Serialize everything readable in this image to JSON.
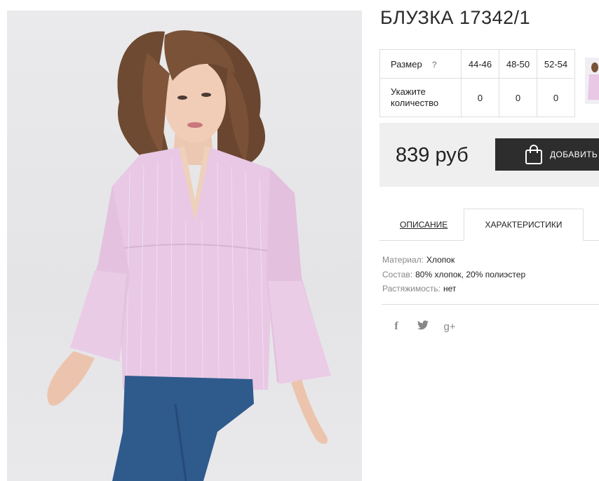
{
  "product": {
    "title": "БЛУЗКА 17342/1",
    "price": "839 руб",
    "add_button_label": "ДОБАВИТЬ"
  },
  "sizes_table": {
    "size_label": "Размер",
    "help_icon": "?",
    "sizes": [
      "44-46",
      "48-50",
      "52-54"
    ],
    "quantity_label": "Укажите количество",
    "quantities": [
      "0",
      "0",
      "0"
    ]
  },
  "tabs": [
    {
      "label": "ОПИСАНИЕ",
      "active": false
    },
    {
      "label": "ХАРАКТЕРИСТИКИ",
      "active": true
    }
  ],
  "specs": [
    {
      "key": "Материал:",
      "value": "Хлопок"
    },
    {
      "key": "Состав:",
      "value": "80% хлопок, 20% полиэстер"
    },
    {
      "key": "Растяжимость:",
      "value": "нет"
    }
  ],
  "social": {
    "facebook": "f",
    "twitter": "twitter-icon",
    "google_plus": "g+"
  },
  "colors": {
    "button_bg": "#2d2d2d",
    "buybox_bg": "#efefef",
    "blouse_pink": "#e7c6e3",
    "jeans_blue": "#2f5a8c"
  }
}
